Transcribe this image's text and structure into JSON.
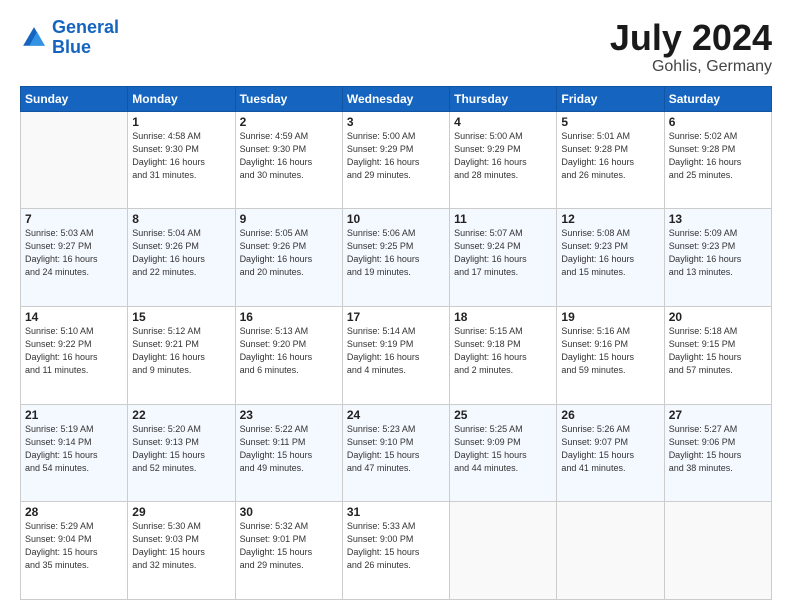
{
  "logo": {
    "line1": "General",
    "line2": "Blue"
  },
  "title": "July 2024",
  "subtitle": "Gohlis, Germany",
  "columns": [
    "Sunday",
    "Monday",
    "Tuesday",
    "Wednesday",
    "Thursday",
    "Friday",
    "Saturday"
  ],
  "weeks": [
    [
      {
        "day": "",
        "info": ""
      },
      {
        "day": "1",
        "info": "Sunrise: 4:58 AM\nSunset: 9:30 PM\nDaylight: 16 hours\nand 31 minutes."
      },
      {
        "day": "2",
        "info": "Sunrise: 4:59 AM\nSunset: 9:30 PM\nDaylight: 16 hours\nand 30 minutes."
      },
      {
        "day": "3",
        "info": "Sunrise: 5:00 AM\nSunset: 9:29 PM\nDaylight: 16 hours\nand 29 minutes."
      },
      {
        "day": "4",
        "info": "Sunrise: 5:00 AM\nSunset: 9:29 PM\nDaylight: 16 hours\nand 28 minutes."
      },
      {
        "day": "5",
        "info": "Sunrise: 5:01 AM\nSunset: 9:28 PM\nDaylight: 16 hours\nand 26 minutes."
      },
      {
        "day": "6",
        "info": "Sunrise: 5:02 AM\nSunset: 9:28 PM\nDaylight: 16 hours\nand 25 minutes."
      }
    ],
    [
      {
        "day": "7",
        "info": "Sunrise: 5:03 AM\nSunset: 9:27 PM\nDaylight: 16 hours\nand 24 minutes."
      },
      {
        "day": "8",
        "info": "Sunrise: 5:04 AM\nSunset: 9:26 PM\nDaylight: 16 hours\nand 22 minutes."
      },
      {
        "day": "9",
        "info": "Sunrise: 5:05 AM\nSunset: 9:26 PM\nDaylight: 16 hours\nand 20 minutes."
      },
      {
        "day": "10",
        "info": "Sunrise: 5:06 AM\nSunset: 9:25 PM\nDaylight: 16 hours\nand 19 minutes."
      },
      {
        "day": "11",
        "info": "Sunrise: 5:07 AM\nSunset: 9:24 PM\nDaylight: 16 hours\nand 17 minutes."
      },
      {
        "day": "12",
        "info": "Sunrise: 5:08 AM\nSunset: 9:23 PM\nDaylight: 16 hours\nand 15 minutes."
      },
      {
        "day": "13",
        "info": "Sunrise: 5:09 AM\nSunset: 9:23 PM\nDaylight: 16 hours\nand 13 minutes."
      }
    ],
    [
      {
        "day": "14",
        "info": "Sunrise: 5:10 AM\nSunset: 9:22 PM\nDaylight: 16 hours\nand 11 minutes."
      },
      {
        "day": "15",
        "info": "Sunrise: 5:12 AM\nSunset: 9:21 PM\nDaylight: 16 hours\nand 9 minutes."
      },
      {
        "day": "16",
        "info": "Sunrise: 5:13 AM\nSunset: 9:20 PM\nDaylight: 16 hours\nand 6 minutes."
      },
      {
        "day": "17",
        "info": "Sunrise: 5:14 AM\nSunset: 9:19 PM\nDaylight: 16 hours\nand 4 minutes."
      },
      {
        "day": "18",
        "info": "Sunrise: 5:15 AM\nSunset: 9:18 PM\nDaylight: 16 hours\nand 2 minutes."
      },
      {
        "day": "19",
        "info": "Sunrise: 5:16 AM\nSunset: 9:16 PM\nDaylight: 15 hours\nand 59 minutes."
      },
      {
        "day": "20",
        "info": "Sunrise: 5:18 AM\nSunset: 9:15 PM\nDaylight: 15 hours\nand 57 minutes."
      }
    ],
    [
      {
        "day": "21",
        "info": "Sunrise: 5:19 AM\nSunset: 9:14 PM\nDaylight: 15 hours\nand 54 minutes."
      },
      {
        "day": "22",
        "info": "Sunrise: 5:20 AM\nSunset: 9:13 PM\nDaylight: 15 hours\nand 52 minutes."
      },
      {
        "day": "23",
        "info": "Sunrise: 5:22 AM\nSunset: 9:11 PM\nDaylight: 15 hours\nand 49 minutes."
      },
      {
        "day": "24",
        "info": "Sunrise: 5:23 AM\nSunset: 9:10 PM\nDaylight: 15 hours\nand 47 minutes."
      },
      {
        "day": "25",
        "info": "Sunrise: 5:25 AM\nSunset: 9:09 PM\nDaylight: 15 hours\nand 44 minutes."
      },
      {
        "day": "26",
        "info": "Sunrise: 5:26 AM\nSunset: 9:07 PM\nDaylight: 15 hours\nand 41 minutes."
      },
      {
        "day": "27",
        "info": "Sunrise: 5:27 AM\nSunset: 9:06 PM\nDaylight: 15 hours\nand 38 minutes."
      }
    ],
    [
      {
        "day": "28",
        "info": "Sunrise: 5:29 AM\nSunset: 9:04 PM\nDaylight: 15 hours\nand 35 minutes."
      },
      {
        "day": "29",
        "info": "Sunrise: 5:30 AM\nSunset: 9:03 PM\nDaylight: 15 hours\nand 32 minutes."
      },
      {
        "day": "30",
        "info": "Sunrise: 5:32 AM\nSunset: 9:01 PM\nDaylight: 15 hours\nand 29 minutes."
      },
      {
        "day": "31",
        "info": "Sunrise: 5:33 AM\nSunset: 9:00 PM\nDaylight: 15 hours\nand 26 minutes."
      },
      {
        "day": "",
        "info": ""
      },
      {
        "day": "",
        "info": ""
      },
      {
        "day": "",
        "info": ""
      }
    ]
  ]
}
